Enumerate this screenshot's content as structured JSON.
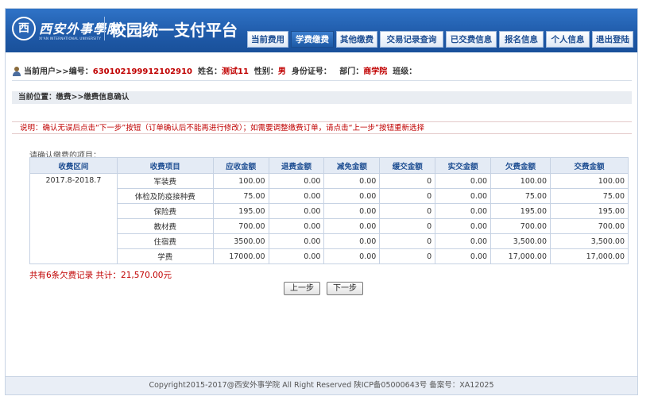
{
  "logo": {
    "name": "西安外事學院",
    "subtitle": "XI'AN INTERNATIONAL UNIVERSITY",
    "glyph": "西"
  },
  "site_title": "校园统一支付平台",
  "nav": [
    {
      "label": "当前费用",
      "active": false
    },
    {
      "label": "学费缴费",
      "active": true
    },
    {
      "label": "其他缴费",
      "active": false
    },
    {
      "label": "交易记录查询",
      "active": false
    },
    {
      "label": "已交费信息",
      "active": false
    },
    {
      "label": "报名信息",
      "active": false
    },
    {
      "label": "个人信息",
      "active": false
    },
    {
      "label": "退出登陆",
      "active": false
    }
  ],
  "user": {
    "prefix": "当前用户>>编号：",
    "id": "630102199912102910",
    "name_label": "姓名：",
    "name": "测试11",
    "gender_label": "性别：",
    "gender": "男",
    "idcard_label": "身份证号：",
    "dept_label": "部门：",
    "dept": "商学院",
    "class_label": "班级："
  },
  "breadcrumb": "当前位置：缴费>>缴费信息确认",
  "notice": "说明：确认无误后点击“下一步”按钮（订单确认后不能再进行修改）；如需要调整缴费订单，请点击“上一步”按钮重新选择",
  "confirm_label": "请确认缴费的项目：",
  "table": {
    "headers": [
      "收费区间",
      "收费项目",
      "应收金额",
      "退费金额",
      "减免金额",
      "缓交金额",
      "实交金额",
      "欠费金额",
      "交费金额"
    ],
    "period": "2017.8-2018.7",
    "rows": [
      [
        "军装费",
        "100.00",
        "0.00",
        "0.00",
        "0",
        "0.00",
        "100.00",
        "100.00"
      ],
      [
        "体检及防疫接种费",
        "75.00",
        "0.00",
        "0.00",
        "0",
        "0.00",
        "75.00",
        "75.00"
      ],
      [
        "保险费",
        "195.00",
        "0.00",
        "0.00",
        "0",
        "0.00",
        "195.00",
        "195.00"
      ],
      [
        "教材费",
        "700.00",
        "0.00",
        "0.00",
        "0",
        "0.00",
        "700.00",
        "700.00"
      ],
      [
        "住宿费",
        "3500.00",
        "0.00",
        "0.00",
        "0",
        "0.00",
        "3,500.00",
        "3,500.00"
      ],
      [
        "学费",
        "17000.00",
        "0.00",
        "0.00",
        "0",
        "0.00",
        "17,000.00",
        "17,000.00"
      ]
    ]
  },
  "summary": "共有6条欠费记录 共计：21,570.00元",
  "buttons": {
    "prev": "上一步",
    "next": "下一步"
  },
  "footer": "Copyright2015-2017@西安外事学院   All Right Reserved   陕ICP备05000643号   备案号：XA12025",
  "colors": {
    "header": "#1f5aa8",
    "accent_red": "#c00000",
    "table_header": "#e4ebf5"
  }
}
